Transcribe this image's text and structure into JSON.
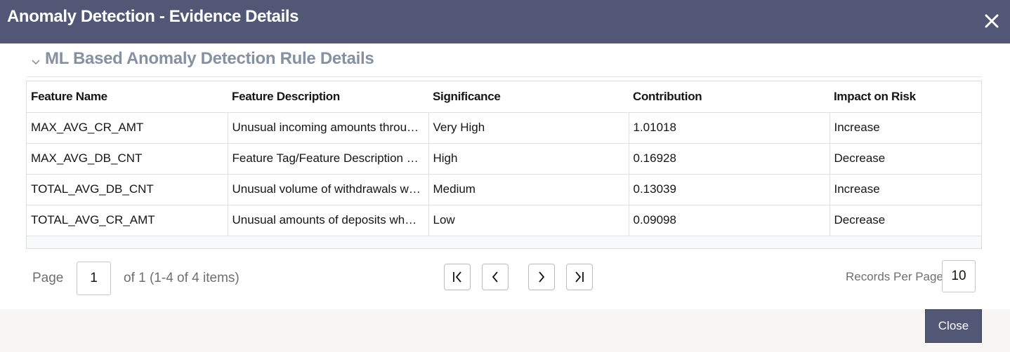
{
  "dialog": {
    "title": "Anomaly Detection - Evidence Details"
  },
  "section": {
    "title": "ML Based Anomaly Detection Rule Details",
    "expanded": true
  },
  "table": {
    "columns": [
      "Feature Name",
      "Feature Description",
      "Significance",
      "Contribution",
      "Impact on Risk"
    ],
    "rows": [
      [
        "MAX_AVG_CR_AMT",
        "Unusual incoming amounts throu…",
        "Very High",
        "1.01018",
        "Increase"
      ],
      [
        "MAX_AVG_DB_CNT",
        "Feature Tag/Feature Description …",
        "High",
        "0.16928",
        "Decrease"
      ],
      [
        "TOTAL_AVG_DB_CNT",
        "Unusual volume of withdrawals w…",
        "Medium",
        "0.13039",
        "Increase"
      ],
      [
        "TOTAL_AVG_CR_AMT",
        "Unusual amounts of deposits wh…",
        "Low",
        "0.09098",
        "Decrease"
      ]
    ]
  },
  "pager": {
    "page_label": "Page",
    "page_value": "1",
    "summary": "of 1 (1-4 of 4 items)",
    "records_per_page_label": "Records Per Page",
    "records_per_page_value": "10"
  },
  "footer": {
    "close_label": "Close"
  },
  "icons": {
    "close": "close-icon",
    "chevron": "chevron-down-icon",
    "first": "first-page-icon",
    "prev": "previous-page-icon",
    "next": "next-page-icon",
    "last": "last-page-icon"
  },
  "colors": {
    "header_bg": "#525775",
    "section_title": "#8590a0",
    "button_bg": "#525775"
  }
}
